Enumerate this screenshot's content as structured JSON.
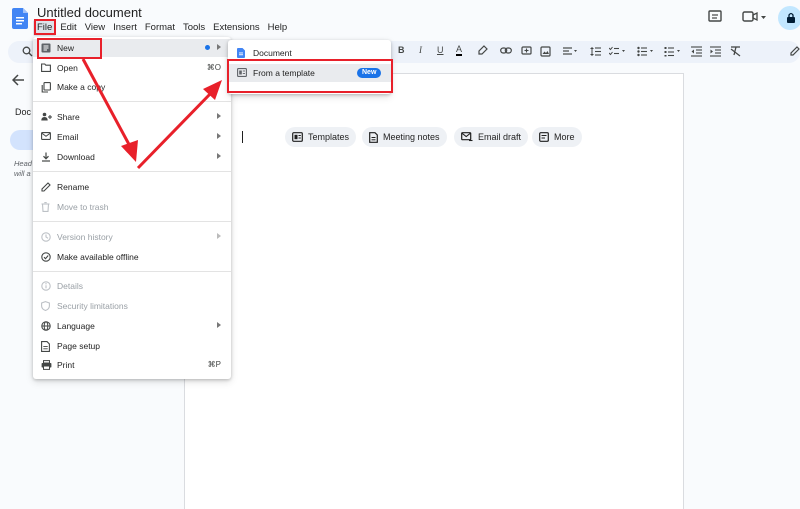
{
  "app": {
    "title": "Untitled document",
    "menubar": [
      "File",
      "Edit",
      "View",
      "Insert",
      "Format",
      "Tools",
      "Extensions",
      "Help"
    ]
  },
  "left_panel": {
    "tab_label": "Doc",
    "hint_line1": "Head",
    "hint_line2": "will a"
  },
  "toolbar": {
    "bold": "B",
    "italic": "I",
    "underline": "U",
    "text_color": "A"
  },
  "canvas_chips": [
    {
      "label": "Templates",
      "icon": "template-icon"
    },
    {
      "label": "Meeting notes",
      "icon": "document-icon"
    },
    {
      "label": "Email draft",
      "icon": "email-icon"
    },
    {
      "label": "More",
      "icon": "more-doc-icon"
    }
  ],
  "file_menu": {
    "new": {
      "label": "New",
      "icon": "new-doc-icon"
    },
    "open": {
      "label": "Open",
      "icon": "folder-icon",
      "shortcut": "⌘O"
    },
    "make_copy": {
      "label": "Make a copy",
      "icon": "copy-icon"
    },
    "share": {
      "label": "Share",
      "icon": "share-icon"
    },
    "email": {
      "label": "Email",
      "icon": "email-icon"
    },
    "download": {
      "label": "Download",
      "icon": "download-icon"
    },
    "rename": {
      "label": "Rename",
      "icon": "pencil-icon"
    },
    "move_to_trash": {
      "label": "Move to trash",
      "icon": "trash-icon"
    },
    "version_history": {
      "label": "Version history",
      "icon": "history-icon"
    },
    "make_offline": {
      "label": "Make available offline",
      "icon": "offline-icon"
    },
    "details": {
      "label": "Details",
      "icon": "info-icon"
    },
    "security_limitations": {
      "label": "Security limitations",
      "icon": "shield-icon"
    },
    "language": {
      "label": "Language",
      "icon": "globe-icon"
    },
    "page_setup": {
      "label": "Page setup",
      "icon": "page-setup-icon"
    },
    "print": {
      "label": "Print",
      "icon": "print-icon",
      "shortcut": "⌘P"
    }
  },
  "new_submenu": {
    "document": {
      "label": "Document",
      "icon": "docs-icon"
    },
    "from_template": {
      "label": "From a template",
      "icon": "template-icon",
      "badge": "New"
    }
  },
  "colors": {
    "accent_blue": "#1a73e8",
    "annotation_red": "#e8202a",
    "toolbar_bg": "#edf2fa"
  }
}
